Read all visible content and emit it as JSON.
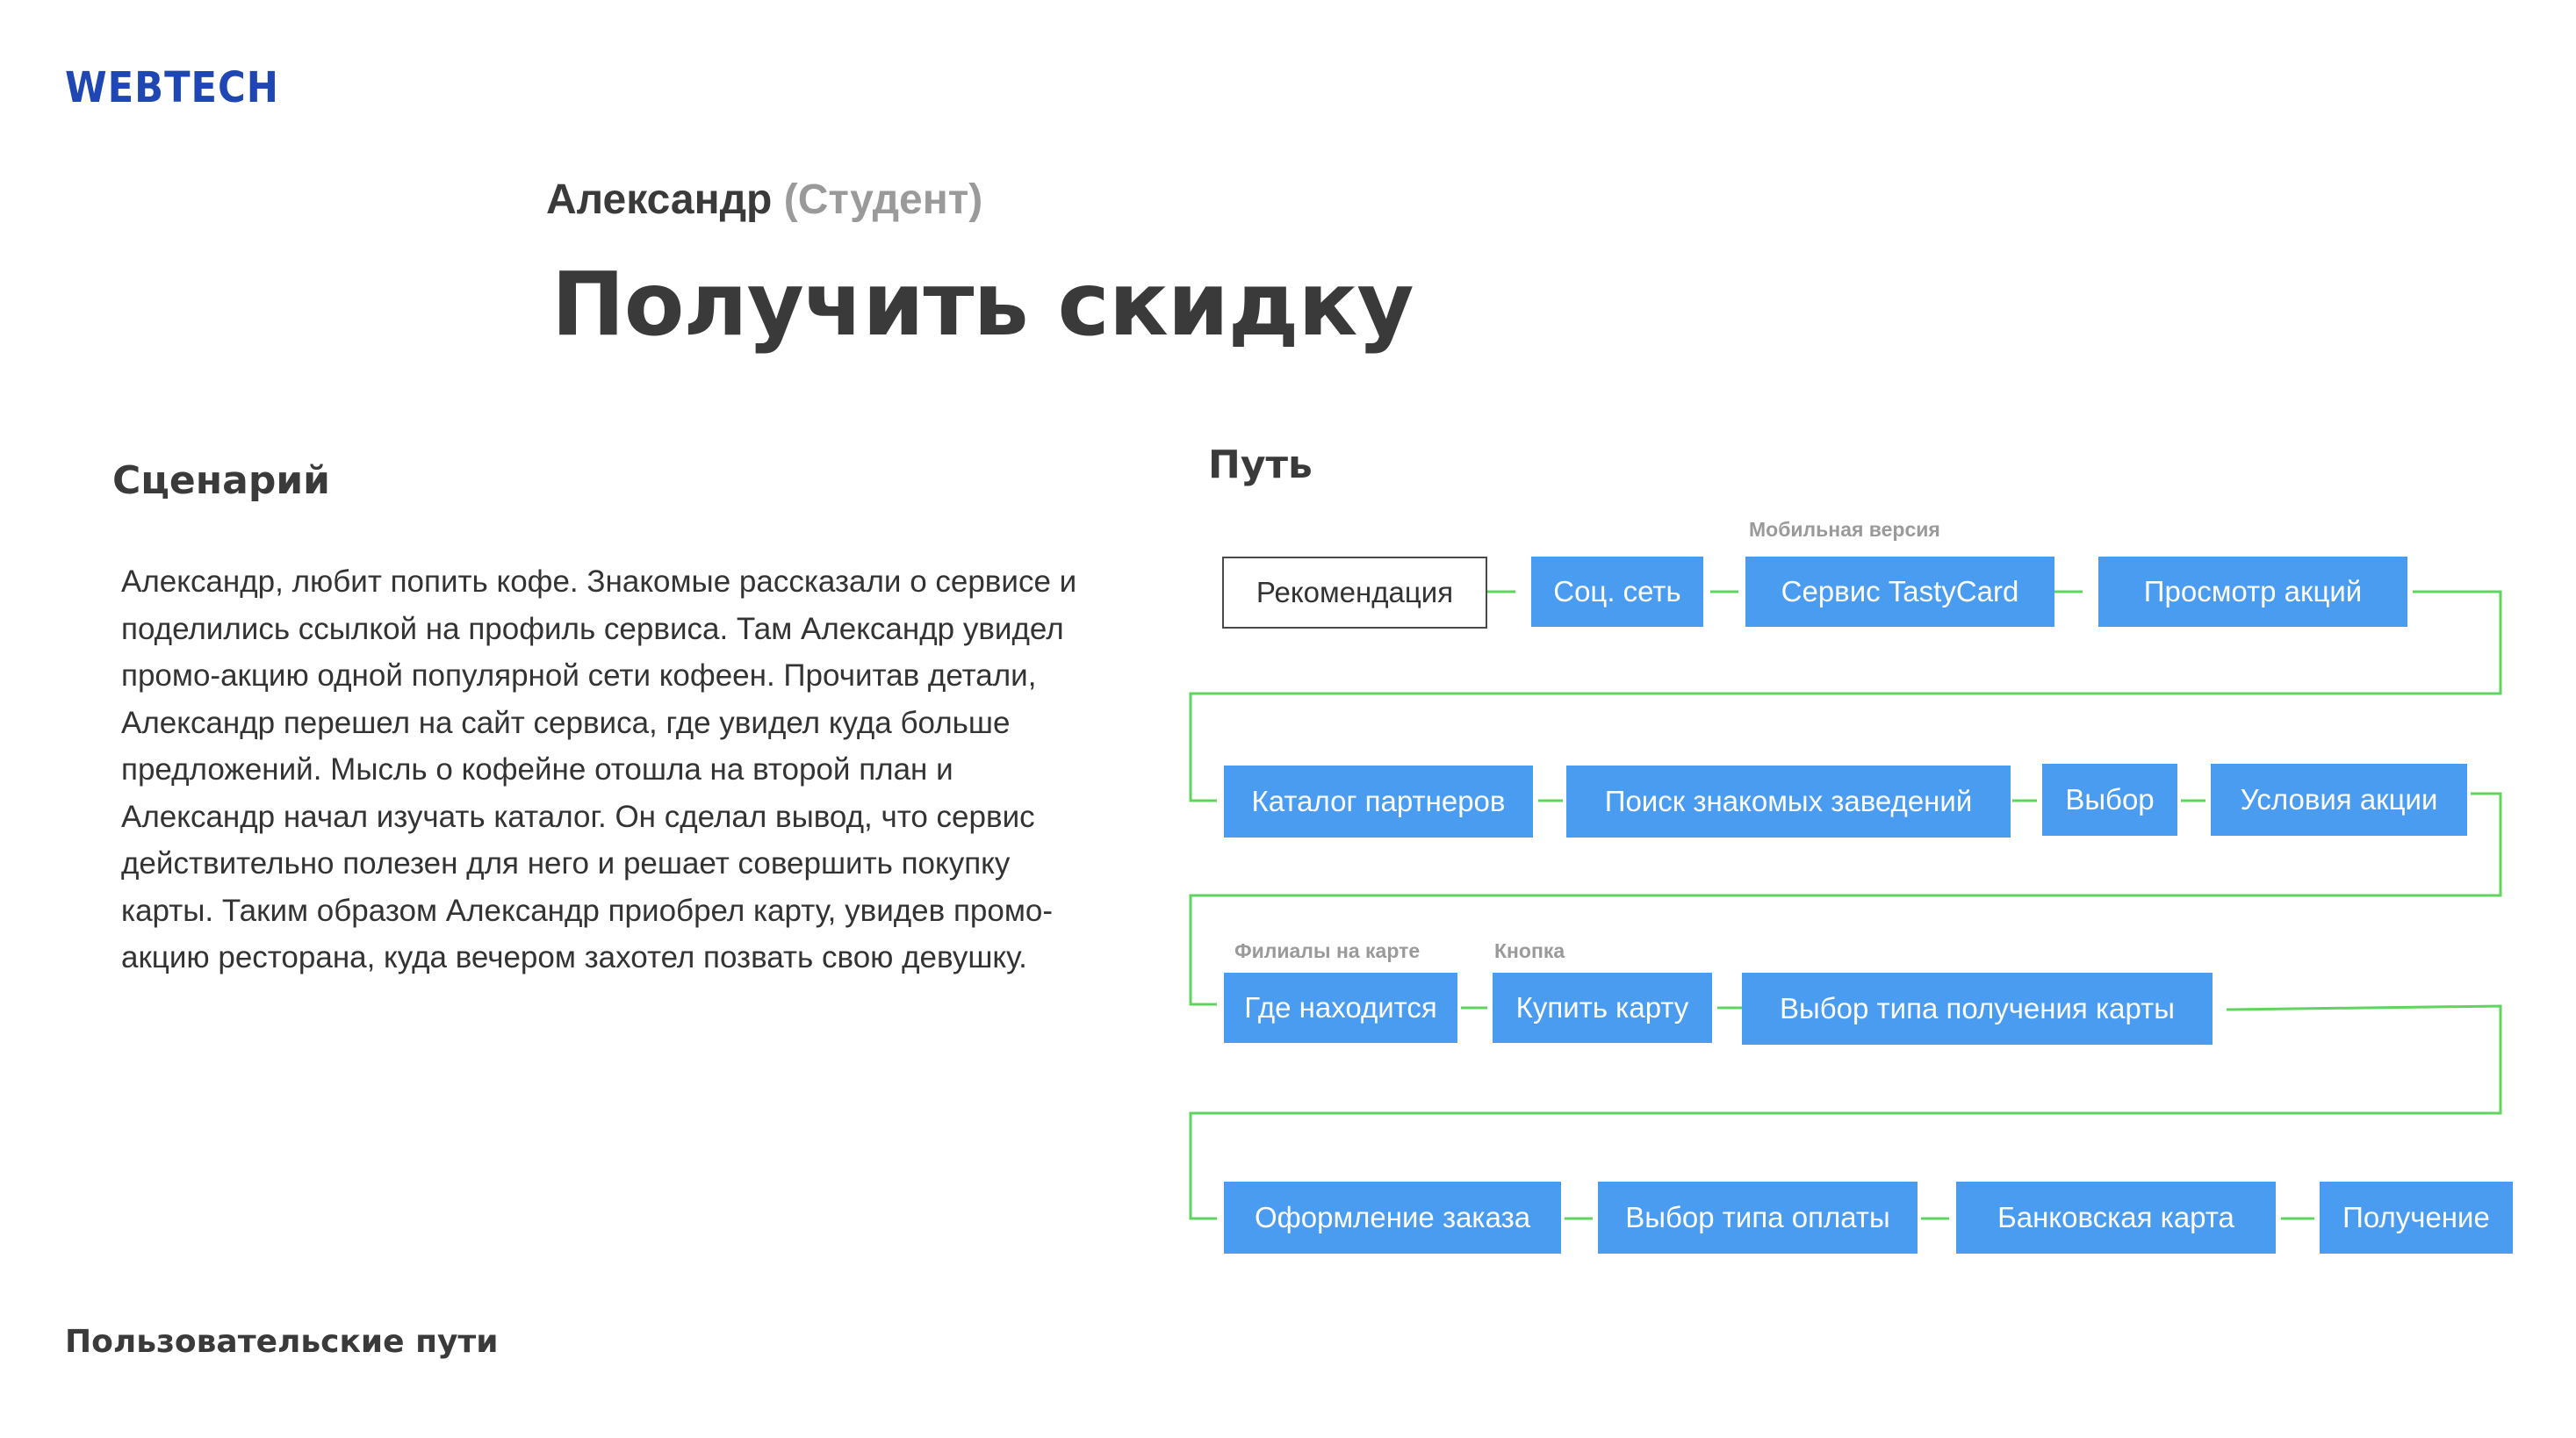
{
  "brand": {
    "logo": "WEBTECH"
  },
  "header": {
    "persona_name": "Александр",
    "persona_role": "(Студент)",
    "title": "Получить скидку"
  },
  "scenario": {
    "heading": "Сценарий",
    "text": "Александр, любит попить кофе. Знакомые рассказали о сервисе и поделились ссылкой на профиль сервиса. Там Александр увидел промо-акцию одной популярной сети кофеен. Прочитав детали, Александр перешел на сайт сервиса, где увидел куда больше предложений. Мысль о кофейне отошла на второй план и Александр начал изучать каталог. Он сделал вывод, что сервис действительно полезен для него и решает совершить покупку карты. Таким образом Александр приобрел карту, увидев промо-акцию ресторана, куда вечером захотел позвать свою девушку."
  },
  "path": {
    "heading": "Путь",
    "nodes": [
      "Рекомендация",
      "Соц. сеть",
      "Сервис TastyCard",
      "Просмотр акций",
      "Каталог партнеров",
      "Поиск знакомых заведений",
      "Выбор",
      "Условия акции",
      "Где находится",
      "Купить карту",
      "Выбор типа получения карты",
      "Оформление заказа",
      "Выбор типа оплаты",
      "Банковская карта",
      "Получение"
    ],
    "notes": [
      "Мобильная версия",
      "Филиалы на карте",
      "Кнопка"
    ]
  },
  "footer": {
    "label": "Пользовательские пути"
  },
  "colors": {
    "brand": "#1f47b3",
    "node": "#4a9cf0",
    "connector": "#5fd45f",
    "muted": "#9a9a9a"
  }
}
